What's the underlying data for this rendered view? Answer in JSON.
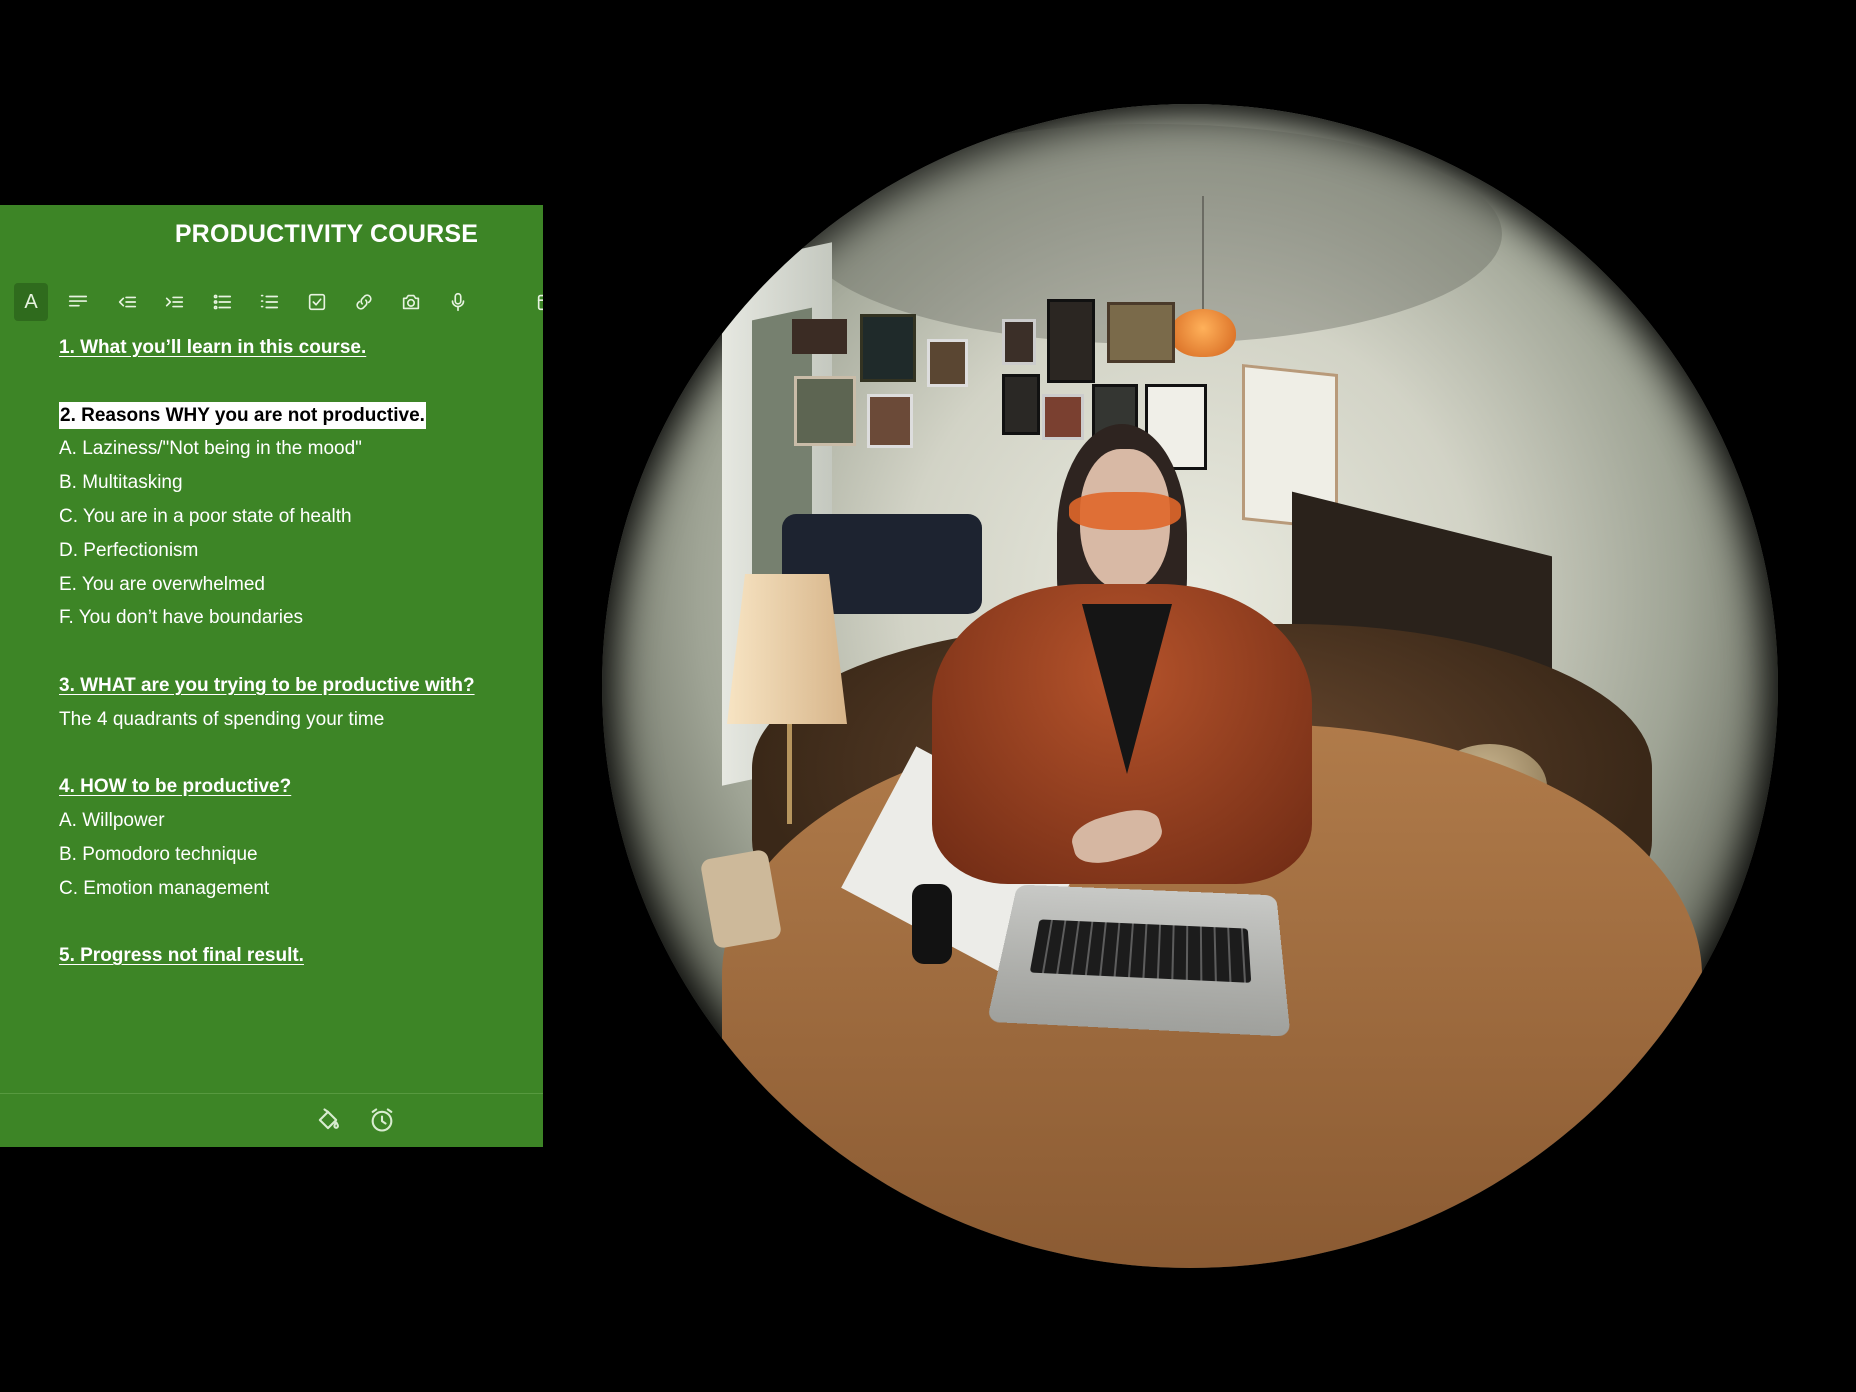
{
  "notes": {
    "title": "PRODUCTIVITY COURSE",
    "toolbar": {
      "format_label": "A",
      "icons": [
        "text-format-icon",
        "align-text-icon",
        "outdent-icon",
        "indent-icon",
        "bulleted-list-icon",
        "numbered-list-icon",
        "checkbox-icon",
        "link-icon",
        "camera-icon",
        "microphone-icon",
        "calendar-icon"
      ]
    },
    "lines": [
      {
        "text": "1. What you’ll learn in this course.",
        "style": "heading"
      },
      {
        "text": "",
        "style": "blank"
      },
      {
        "text": "2. Reasons WHY you are not productive.",
        "style": "heading-highlight"
      },
      {
        "text": "A. Laziness/\"Not being in the mood\"",
        "style": "plain"
      },
      {
        "text": "B. Multitasking",
        "style": "plain"
      },
      {
        "text": "C. You are in a poor state of health",
        "style": "plain"
      },
      {
        "text": "D. Perfectionism",
        "style": "plain"
      },
      {
        "text": "E. You are overwhelmed",
        "style": "plain"
      },
      {
        "text": "F. You don’t have boundaries",
        "style": "plain"
      },
      {
        "text": "",
        "style": "blank"
      },
      {
        "text": "3. WHAT are you trying to be productive with?",
        "style": "heading"
      },
      {
        "text": "The 4 quadrants of spending your time",
        "style": "plain"
      },
      {
        "text": "",
        "style": "blank"
      },
      {
        "text": "4. HOW to be productive?",
        "style": "heading"
      },
      {
        "text": "A. Willpower",
        "style": "plain"
      },
      {
        "text": "B. Pomodoro technique",
        "style": "plain"
      },
      {
        "text": "C. Emotion management",
        "style": "plain"
      },
      {
        "text": "",
        "style": "blank"
      },
      {
        "text": "5. Progress not final result.",
        "style": "heading"
      }
    ],
    "bottom_icons": [
      "paint-bucket-icon",
      "alarm-clock-icon"
    ],
    "colors": {
      "panel": "#3d8526",
      "highlight": "#ffffff"
    }
  }
}
